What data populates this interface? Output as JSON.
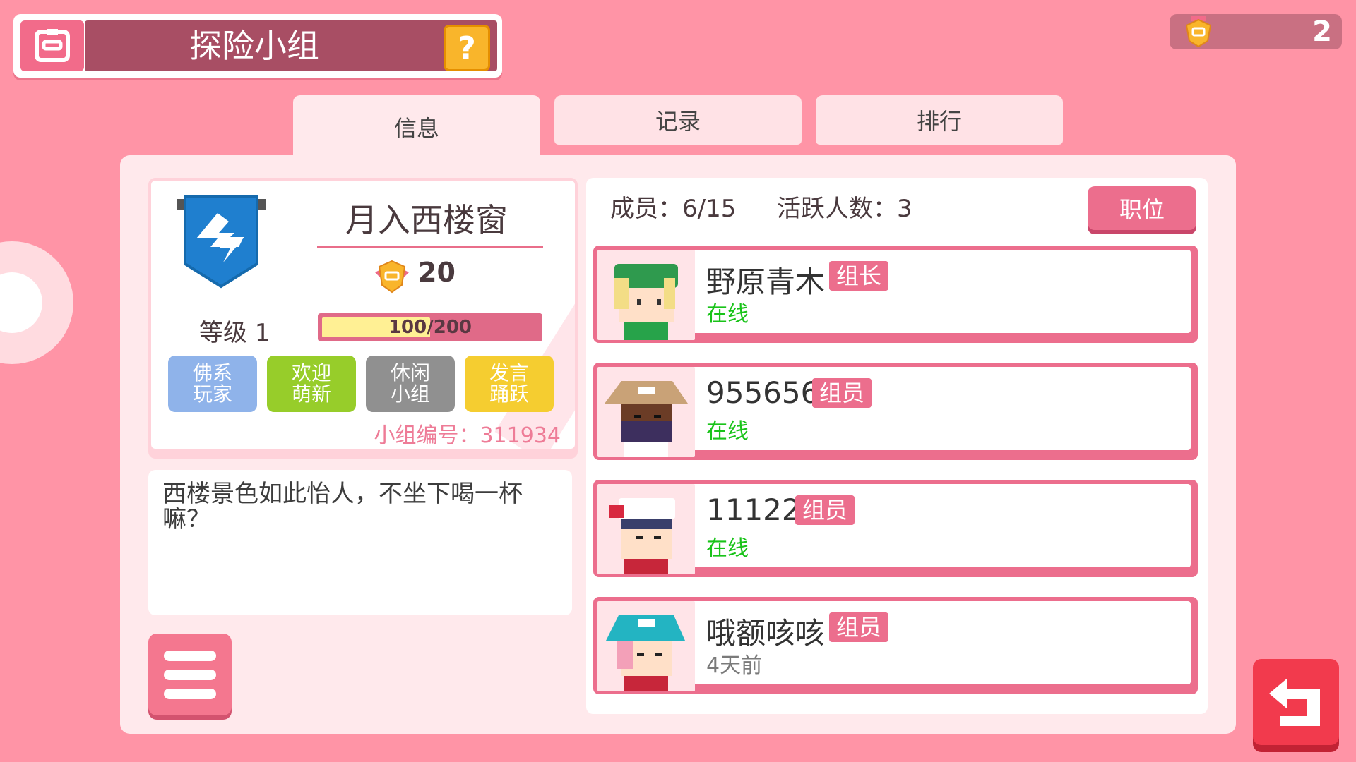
{
  "header": {
    "title": "探险小组",
    "help_label": "?"
  },
  "currency": {
    "value": "2",
    "icon": "badge-icon"
  },
  "tabs": [
    {
      "label": "信息",
      "active": true
    },
    {
      "label": "记录",
      "active": false
    },
    {
      "label": "排行",
      "active": false
    }
  ],
  "group": {
    "emblem_icon": "shield-lightning-icon",
    "name": "月入西楼窗",
    "points": "20",
    "level": "等级 1",
    "exp_current": "100",
    "exp_max": "200",
    "exp_text": "100/200",
    "exp_fraction": 0.5,
    "tags": [
      {
        "label": "佛系\n玩家",
        "color": "#8fb3ea"
      },
      {
        "label": "欢迎\n萌新",
        "color": "#97cd2a"
      },
      {
        "label": "休闲\n小组",
        "color": "#909090"
      },
      {
        "label": "发言\n踊跃",
        "color": "#f5cd30"
      }
    ],
    "group_id": "小组编号：311934",
    "description": "西楼景色如此怡人，不坐下喝一杯嘛？"
  },
  "members_panel": {
    "members": "成员：6/15",
    "active": "活跃人数：3",
    "roles_button": "职位",
    "list": [
      {
        "name": "野原青木",
        "role": "组长",
        "status": "在线",
        "online": true,
        "avatar": "avatar-green-hat"
      },
      {
        "name": "955656",
        "role": "组员",
        "status": "在线",
        "online": true,
        "avatar": "avatar-tan-hat"
      },
      {
        "name": "111229",
        "role": "组员",
        "status": "在线",
        "online": true,
        "avatar": "avatar-white-cap"
      },
      {
        "name": "哦额咳咳",
        "role": "组员",
        "status": "4天前",
        "online": false,
        "avatar": "avatar-teal-hat"
      }
    ]
  },
  "colors": {
    "background": "#ff94a6",
    "accent": "#ec6e8d",
    "online": "#19c319",
    "back_button": "#f23a4d"
  }
}
